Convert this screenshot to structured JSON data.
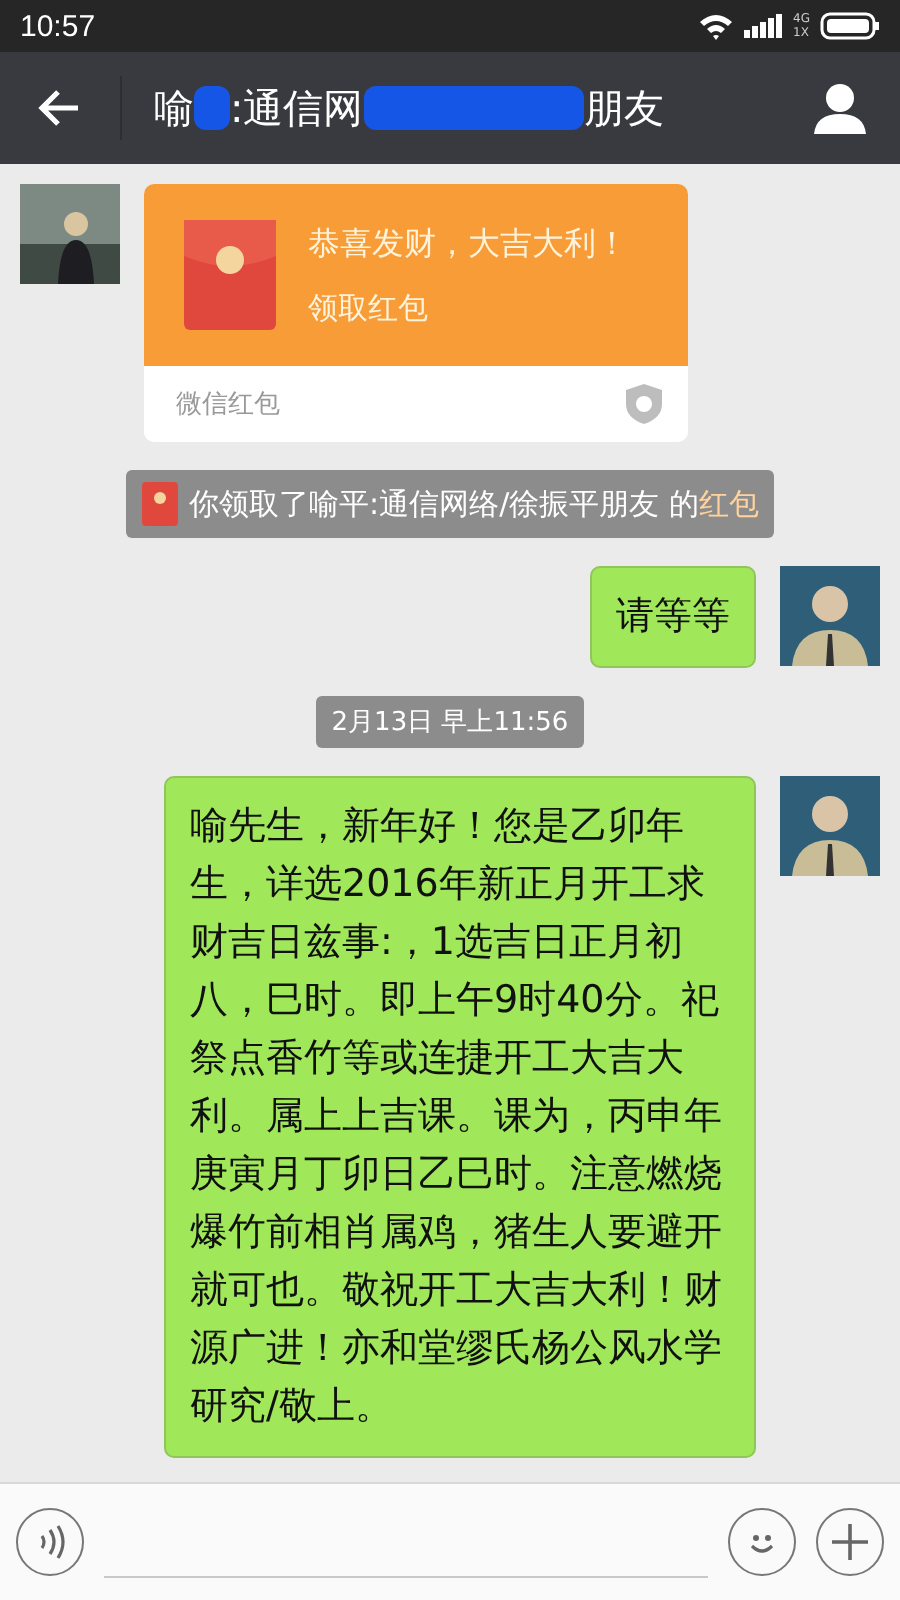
{
  "status_bar": {
    "time": "10:57",
    "network_top": "4G",
    "network_bottom": "1X"
  },
  "header": {
    "title_parts": [
      "喻",
      ":通信网",
      "朋友"
    ]
  },
  "messages": [
    {
      "kind": "red_packet",
      "greeting": "恭喜发财，大吉大利！",
      "action": "领取红包",
      "footer": "微信红包"
    },
    {
      "kind": "notice",
      "text": "你领取了喻平:通信网络/徐振平朋友 的",
      "link": "红包"
    },
    {
      "kind": "text",
      "text": "请等等"
    },
    {
      "kind": "time",
      "text": "2月13日 早上11:56"
    },
    {
      "kind": "text",
      "text": "喻先生，新年好！您是乙卯年生，详选2016年新正月开工求财吉日兹事:，1选吉日正月初八，巳时。即上午9时40分。祀祭点香竹等或连捷开工大吉大利。属上上吉课。课为，丙申年庚寅月丁卯日乙巳时。注意燃烧爆竹前相肖属鸡，猪生人要避开就可也。敬祝开工大吉大利！财源广进！亦和堂缪氏杨公风水学研究/敬上。"
    }
  ]
}
